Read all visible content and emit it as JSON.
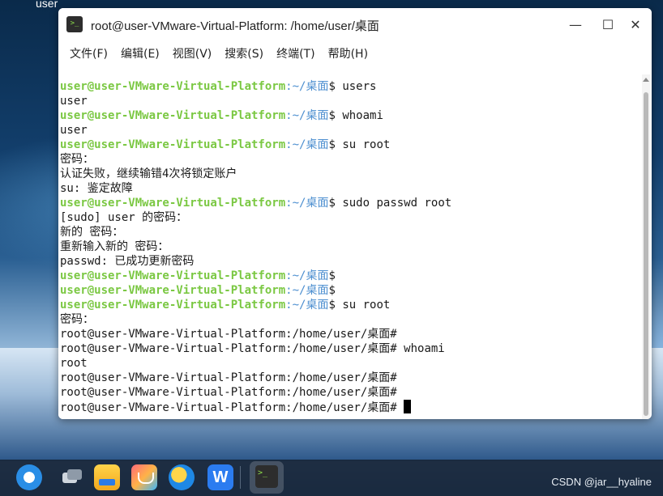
{
  "desktop": {
    "user_label": "user",
    "watermark": "CSDN @jar__hyaline"
  },
  "window": {
    "title": "root@user-VMware-Virtual-Platform: /home/user/桌面",
    "app_icon_glyph": ">_",
    "controls": {
      "minimize": "—",
      "maximize": "☐",
      "close": "✕"
    }
  },
  "menu": [
    "文件(F)",
    "编辑(E)",
    "视图(V)",
    "搜索(S)",
    "终端(T)",
    "帮助(H)"
  ],
  "terminal": {
    "user_prompt": "user@user-VMware-Virtual-Platform",
    "user_path": ":~/桌面",
    "root_prompt": "root@user-VMware-Virtual-Platform:/home/user/桌面#",
    "lines": [
      {
        "type": "user",
        "cmd": " users"
      },
      {
        "type": "out",
        "text": "user"
      },
      {
        "type": "user",
        "cmd": " whoami"
      },
      {
        "type": "out",
        "text": "user"
      },
      {
        "type": "user",
        "cmd": " su root"
      },
      {
        "type": "out",
        "text": "密码："
      },
      {
        "type": "out",
        "text": "认证失败，继续输错4次将锁定账户"
      },
      {
        "type": "out",
        "text": "su: 鉴定故障"
      },
      {
        "type": "user",
        "cmd": " sudo passwd root"
      },
      {
        "type": "out",
        "text": "[sudo] user 的密码："
      },
      {
        "type": "out",
        "text": "新的 密码："
      },
      {
        "type": "out",
        "text": "重新输入新的 密码："
      },
      {
        "type": "out",
        "text": "passwd: 已成功更新密码"
      },
      {
        "type": "user",
        "cmd": ""
      },
      {
        "type": "user",
        "cmd": ""
      },
      {
        "type": "user",
        "cmd": " su root"
      },
      {
        "type": "out",
        "text": "密码："
      },
      {
        "type": "root",
        "cmd": ""
      },
      {
        "type": "root",
        "cmd": " whoami"
      },
      {
        "type": "out",
        "text": "root"
      },
      {
        "type": "root",
        "cmd": ""
      },
      {
        "type": "root",
        "cmd": ""
      },
      {
        "type": "root",
        "cmd": " ",
        "cursor": true
      }
    ]
  },
  "taskbar": {
    "apps": [
      "kylin-start-icon",
      "multitask-view-icon",
      "file-manager-icon",
      "software-store-icon",
      "browser-icon",
      "wps-icon",
      "terminal-icon"
    ]
  },
  "colors": {
    "prompt_user": "#7bc843",
    "prompt_path": "#4d8fd0"
  }
}
